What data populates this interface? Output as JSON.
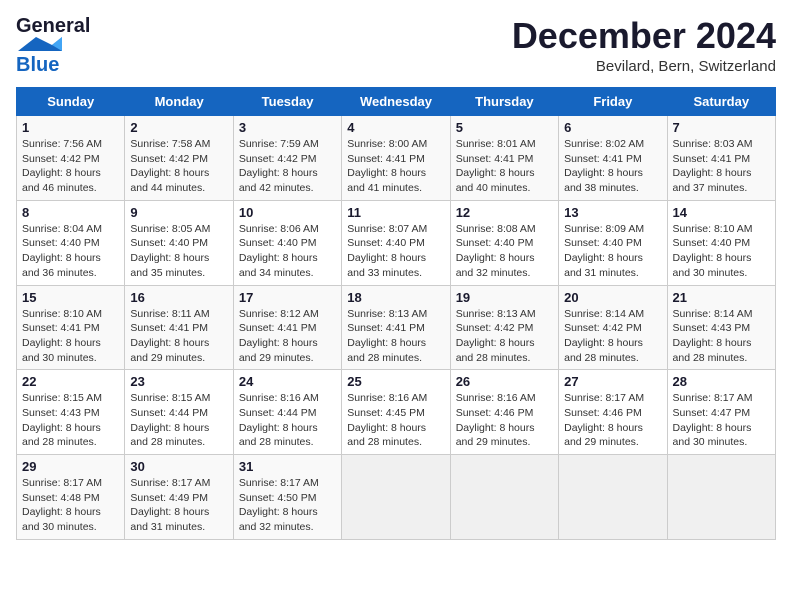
{
  "header": {
    "logo_line1": "General",
    "logo_line2": "Blue",
    "month": "December 2024",
    "location": "Bevilard, Bern, Switzerland"
  },
  "days_of_week": [
    "Sunday",
    "Monday",
    "Tuesday",
    "Wednesday",
    "Thursday",
    "Friday",
    "Saturday"
  ],
  "weeks": [
    [
      {
        "day": "1",
        "rise": "7:56 AM",
        "set": "4:42 PM",
        "daylight": "8 hours and 46 minutes."
      },
      {
        "day": "2",
        "rise": "7:58 AM",
        "set": "4:42 PM",
        "daylight": "8 hours and 44 minutes."
      },
      {
        "day": "3",
        "rise": "7:59 AM",
        "set": "4:42 PM",
        "daylight": "8 hours and 42 minutes."
      },
      {
        "day": "4",
        "rise": "8:00 AM",
        "set": "4:41 PM",
        "daylight": "8 hours and 41 minutes."
      },
      {
        "day": "5",
        "rise": "8:01 AM",
        "set": "4:41 PM",
        "daylight": "8 hours and 40 minutes."
      },
      {
        "day": "6",
        "rise": "8:02 AM",
        "set": "4:41 PM",
        "daylight": "8 hours and 38 minutes."
      },
      {
        "day": "7",
        "rise": "8:03 AM",
        "set": "4:41 PM",
        "daylight": "8 hours and 37 minutes."
      }
    ],
    [
      {
        "day": "8",
        "rise": "8:04 AM",
        "set": "4:40 PM",
        "daylight": "8 hours and 36 minutes."
      },
      {
        "day": "9",
        "rise": "8:05 AM",
        "set": "4:40 PM",
        "daylight": "8 hours and 35 minutes."
      },
      {
        "day": "10",
        "rise": "8:06 AM",
        "set": "4:40 PM",
        "daylight": "8 hours and 34 minutes."
      },
      {
        "day": "11",
        "rise": "8:07 AM",
        "set": "4:40 PM",
        "daylight": "8 hours and 33 minutes."
      },
      {
        "day": "12",
        "rise": "8:08 AM",
        "set": "4:40 PM",
        "daylight": "8 hours and 32 minutes."
      },
      {
        "day": "13",
        "rise": "8:09 AM",
        "set": "4:40 PM",
        "daylight": "8 hours and 31 minutes."
      },
      {
        "day": "14",
        "rise": "8:10 AM",
        "set": "4:40 PM",
        "daylight": "8 hours and 30 minutes."
      }
    ],
    [
      {
        "day": "15",
        "rise": "8:10 AM",
        "set": "4:41 PM",
        "daylight": "8 hours and 30 minutes."
      },
      {
        "day": "16",
        "rise": "8:11 AM",
        "set": "4:41 PM",
        "daylight": "8 hours and 29 minutes."
      },
      {
        "day": "17",
        "rise": "8:12 AM",
        "set": "4:41 PM",
        "daylight": "8 hours and 29 minutes."
      },
      {
        "day": "18",
        "rise": "8:13 AM",
        "set": "4:41 PM",
        "daylight": "8 hours and 28 minutes."
      },
      {
        "day": "19",
        "rise": "8:13 AM",
        "set": "4:42 PM",
        "daylight": "8 hours and 28 minutes."
      },
      {
        "day": "20",
        "rise": "8:14 AM",
        "set": "4:42 PM",
        "daylight": "8 hours and 28 minutes."
      },
      {
        "day": "21",
        "rise": "8:14 AM",
        "set": "4:43 PM",
        "daylight": "8 hours and 28 minutes."
      }
    ],
    [
      {
        "day": "22",
        "rise": "8:15 AM",
        "set": "4:43 PM",
        "daylight": "8 hours and 28 minutes."
      },
      {
        "day": "23",
        "rise": "8:15 AM",
        "set": "4:44 PM",
        "daylight": "8 hours and 28 minutes."
      },
      {
        "day": "24",
        "rise": "8:16 AM",
        "set": "4:44 PM",
        "daylight": "8 hours and 28 minutes."
      },
      {
        "day": "25",
        "rise": "8:16 AM",
        "set": "4:45 PM",
        "daylight": "8 hours and 28 minutes."
      },
      {
        "day": "26",
        "rise": "8:16 AM",
        "set": "4:46 PM",
        "daylight": "8 hours and 29 minutes."
      },
      {
        "day": "27",
        "rise": "8:17 AM",
        "set": "4:46 PM",
        "daylight": "8 hours and 29 minutes."
      },
      {
        "day": "28",
        "rise": "8:17 AM",
        "set": "4:47 PM",
        "daylight": "8 hours and 30 minutes."
      }
    ],
    [
      {
        "day": "29",
        "rise": "8:17 AM",
        "set": "4:48 PM",
        "daylight": "8 hours and 30 minutes."
      },
      {
        "day": "30",
        "rise": "8:17 AM",
        "set": "4:49 PM",
        "daylight": "8 hours and 31 minutes."
      },
      {
        "day": "31",
        "rise": "8:17 AM",
        "set": "4:50 PM",
        "daylight": "8 hours and 32 minutes."
      },
      null,
      null,
      null,
      null
    ]
  ],
  "labels": {
    "sunrise": "Sunrise:",
    "sunset": "Sunset:",
    "daylight": "Daylight:"
  }
}
